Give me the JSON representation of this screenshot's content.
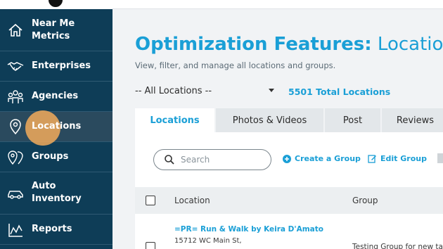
{
  "sidebar": {
    "items": [
      {
        "label_line1": "Near Me",
        "label_line2": "Metrics",
        "icon": "home-icon"
      },
      {
        "label": "Enterprises",
        "icon": "handshake-icon"
      },
      {
        "label": "Agencies",
        "icon": "people-group-icon"
      },
      {
        "label": "Locations",
        "icon": "map-pin-icon"
      },
      {
        "label": "Groups",
        "icon": "double-pin-icon"
      },
      {
        "label_line1": "Auto",
        "label_line2": "Inventory",
        "icon": "car-icon"
      },
      {
        "label": "Reports",
        "icon": "chart-line-icon"
      }
    ],
    "active_item": "Locations"
  },
  "header": {
    "title_bold": "Optimization Features:",
    "title_rest": "Locations",
    "subtitle": "View, filter, and manage all locations and groups."
  },
  "filters": {
    "location_selector": "-- All Locations --",
    "total_locations": "5501 Total Locations"
  },
  "tabs": [
    {
      "label": "Locations",
      "active": true
    },
    {
      "label": "Photos & Videos",
      "active": false
    },
    {
      "label": "Post",
      "active": false
    },
    {
      "label": "Reviews",
      "active": false
    }
  ],
  "toolbar": {
    "search_placeholder": "Search",
    "create_group": "Create a Group",
    "edit_group": "Edit Group"
  },
  "table": {
    "columns": [
      "Location",
      "Group"
    ],
    "rows": [
      {
        "name": "=PR= Run & Walk by Keira D'Amato",
        "address": "15712 WC Main St,",
        "group": "Testing Group for new tab"
      }
    ]
  },
  "colors": {
    "sidebar_bg": "#0e3d57",
    "accent": "#1a9fd6",
    "main_bg": "#f1f3f5",
    "cursor_highlight": "#f2aa5a"
  }
}
